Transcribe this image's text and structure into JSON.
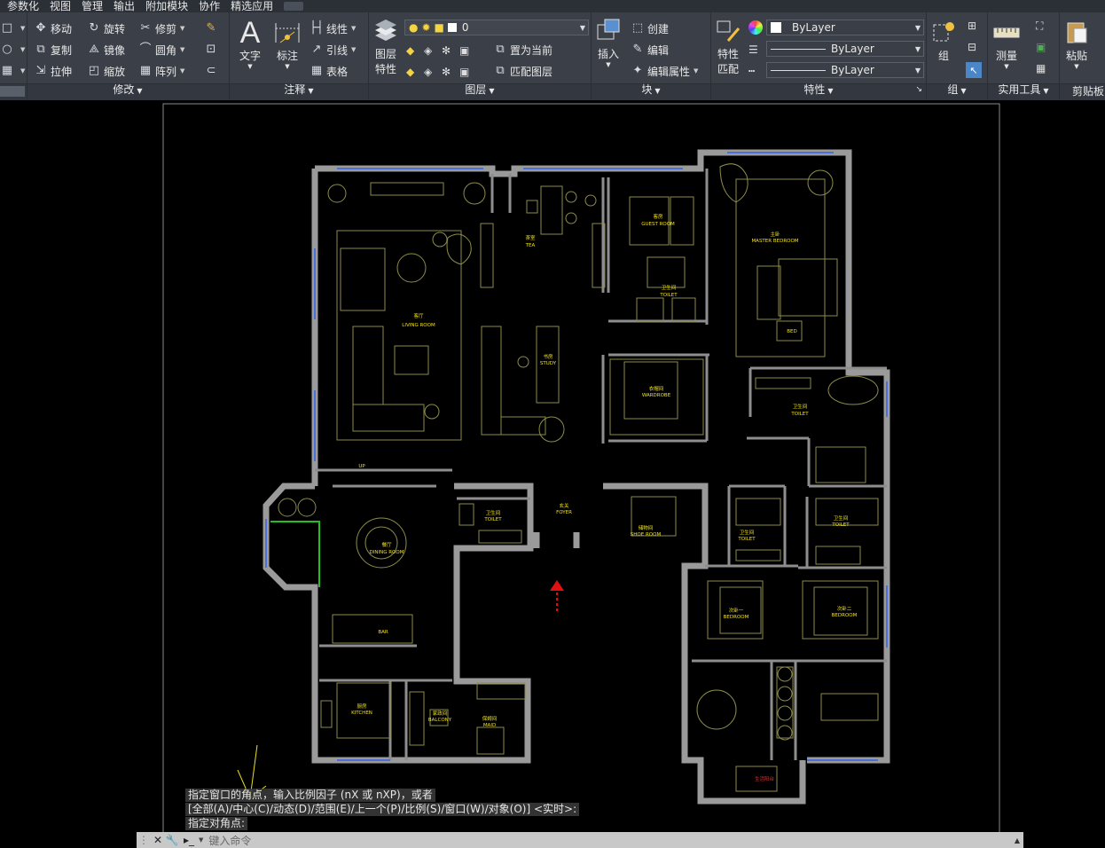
{
  "menu": {
    "items": [
      "参数化",
      "视图",
      "管理",
      "输出",
      "附加模块",
      "协作",
      "精选应用"
    ]
  },
  "ribbon": {
    "modify": {
      "title": "修改",
      "move": "移动",
      "rotate": "旋转",
      "trim": "修剪",
      "copy": "复制",
      "mirror": "镜像",
      "fillet": "圆角",
      "stretch": "拉伸",
      "scale": "缩放",
      "array": "阵列"
    },
    "annotation": {
      "title": "注释",
      "text": "文字",
      "dimension": "标注",
      "linear": "线性",
      "leader": "引线",
      "table": "表格"
    },
    "layers": {
      "title": "图层",
      "properties_l1": "图层",
      "properties_l2": "特性",
      "current_layer": "0",
      "set_current": "置为当前",
      "match_layer": "匹配图层"
    },
    "block": {
      "title": "块",
      "insert": "插入",
      "create": "创建",
      "edit": "编辑",
      "edit_attr": "编辑属性"
    },
    "properties": {
      "title": "特性",
      "match_l1": "特性",
      "match_l2": "匹配",
      "color": "ByLayer",
      "linetype": "ByLayer",
      "lineweight": "ByLayer"
    },
    "groups": {
      "title": "组",
      "group": "组"
    },
    "utilities": {
      "title": "实用工具",
      "measure": "测量"
    },
    "clipboard": {
      "title": "剪贴板",
      "paste": "粘贴"
    }
  },
  "drawing": {
    "rooms": {
      "living": "客厅",
      "living_en": "LIVING ROOM",
      "tea": "茶室",
      "tea_en": "TEA",
      "study": "书房",
      "study_en": "STUDY",
      "guest": "客房",
      "guest_en": "GUEST ROOM",
      "master": "主卧",
      "master_en": "MASTER BEDROOM",
      "bed": "BED",
      "toilet": "卫生间",
      "toilet_en": "TOILET",
      "wardrobe": "衣帽间",
      "wardrobe_en": "WARDROBE",
      "entrance": "玄关",
      "entrance_en": "FOYER",
      "dining": "餐厅",
      "dining_en": "DINING ROOM",
      "bar": "BAR",
      "kitchen": "厨房",
      "kitchen_en": "KITCHEN",
      "laundry": "家政间",
      "laundry_en": "BALCONY",
      "storage": "保姆间",
      "storage_en": "MAID",
      "shoe": "储物间",
      "shoe_en": "SHOE ROOM",
      "bedroom1": "次卧一",
      "bedroom1_en": "BEDROOM",
      "bedroom2": "次卧二",
      "bedroom2_en": "BEDROOM",
      "balcony_red": "生活阳台",
      "up": "UP"
    }
  },
  "command": {
    "history1": "指定窗口的角点，输入比例因子 (nX 或 nXP)，或者",
    "history2": "[全部(A)/中心(C)/动态(D)/范围(E)/上一个(P)/比例(S)/窗口(W)/对象(O)] <实时>:",
    "history3": "指定对角点:",
    "placeholder": "键入命令"
  }
}
